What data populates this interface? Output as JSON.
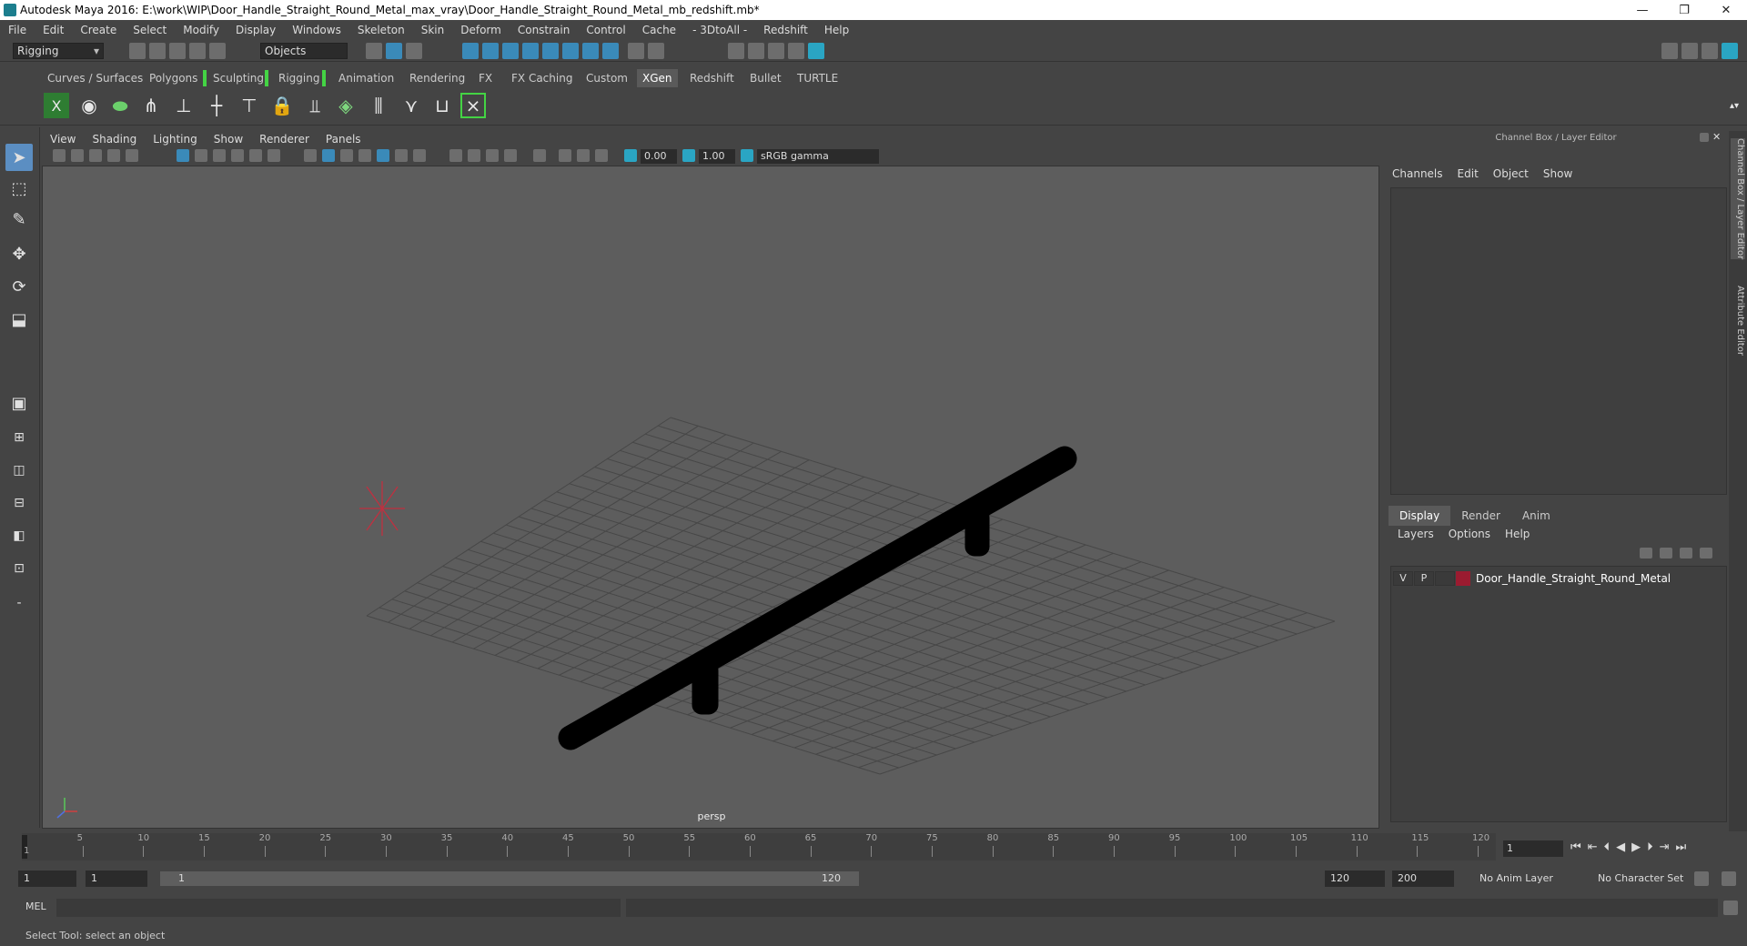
{
  "window": {
    "title": "Autodesk Maya 2016: E:\\work\\WIP\\Door_Handle_Straight_Round_Metal_max_vray\\Door_Handle_Straight_Round_Metal_mb_redshift.mb*",
    "minimize": "—",
    "restore": "❐",
    "close": "✕"
  },
  "menubar": [
    "File",
    "Edit",
    "Create",
    "Select",
    "Modify",
    "Display",
    "Windows",
    "Skeleton",
    "Skin",
    "Deform",
    "Constrain",
    "Control",
    "Cache",
    "- 3DtoAll -",
    "Redshift",
    "Help"
  ],
  "statusline": {
    "mode": "Rigging",
    "object_mode": "Objects"
  },
  "shelf_tabs": [
    "Curves / Surfaces",
    "Polygons",
    "Sculpting",
    "Rigging",
    "Animation",
    "Rendering",
    "FX",
    "FX Caching",
    "Custom",
    "XGen",
    "Redshift",
    "Bullet",
    "TURTLE"
  ],
  "active_shelf": "XGen",
  "viewport": {
    "menu": [
      "View",
      "Shading",
      "Lighting",
      "Show",
      "Renderer",
      "Panels"
    ],
    "exposure": "0.00",
    "gamma": "1.00",
    "color_space": "sRGB gamma",
    "camera_label": "persp"
  },
  "right_panel": {
    "title": "Channel Box / Layer Editor",
    "channel_menu": [
      "Channels",
      "Edit",
      "Object",
      "Show"
    ],
    "layer_tabs": [
      "Display",
      "Render",
      "Anim"
    ],
    "active_layer_tab": "Display",
    "layer_menu": [
      "Layers",
      "Options",
      "Help"
    ],
    "layers": [
      {
        "v": "V",
        "p": "P",
        "name": "Door_Handle_Straight_Round_Metal",
        "color": "#9b1b30"
      }
    ],
    "side_tabs": [
      "Channel Box / Layer Editor",
      "Attribute Editor"
    ]
  },
  "timeline": {
    "ticks": [
      "5",
      "10",
      "15",
      "20",
      "25",
      "30",
      "35",
      "40",
      "45",
      "50",
      "55",
      "60",
      "65",
      "70",
      "75",
      "80",
      "85",
      "90",
      "95",
      "100",
      "105",
      "110",
      "115",
      "120"
    ],
    "start_label": "1",
    "current_frame": "1"
  },
  "range": {
    "start": "1",
    "playback_start": "1",
    "slider_start": "1",
    "slider_end": "120",
    "playback_end": "120",
    "end": "200",
    "anim_layer": "No Anim Layer",
    "char_set": "No Character Set"
  },
  "command": {
    "label": "MEL"
  },
  "helpline": "Select Tool: select an object"
}
